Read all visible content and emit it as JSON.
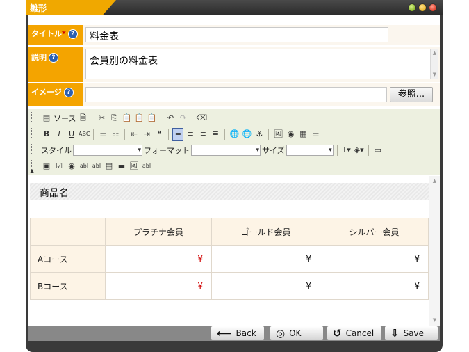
{
  "window": {
    "title": "雛形"
  },
  "form": {
    "title": {
      "label": "タイトル",
      "required": "*",
      "value": "料金表"
    },
    "description": {
      "label": "説明",
      "value": "会員別の料金表"
    },
    "image": {
      "label": "イメージ",
      "value": "",
      "browse_label": "参照..."
    }
  },
  "editor": {
    "source_label": "ソース",
    "style_label": "スタイル",
    "format_label": "フォーマット",
    "size_label": "サイズ",
    "style_value": "",
    "format_value": "",
    "size_value": ""
  },
  "document": {
    "product_name": "商品名",
    "columns": [
      "",
      "プラチナ会員",
      "ゴールド会員",
      "シルバー会員"
    ],
    "rows": [
      {
        "name": "Aコース",
        "values": [
          "¥",
          "¥",
          "¥"
        ]
      },
      {
        "name": "Bコース",
        "values": [
          "¥",
          "¥",
          "¥"
        ]
      }
    ]
  },
  "footer": {
    "back": "Back",
    "ok": "OK",
    "cancel": "Cancel",
    "save": "Save"
  },
  "colors": {
    "accent": "#f4a400",
    "yen_red": "#d00000"
  }
}
